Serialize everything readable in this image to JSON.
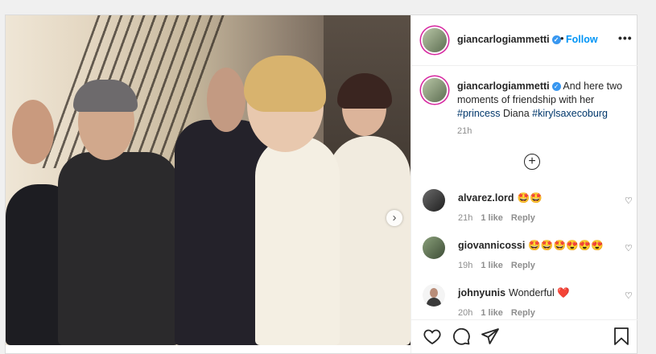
{
  "post": {
    "author": "giancarlogiammetti",
    "follow_label": "Follow",
    "separator": "•",
    "verified_mark": "✓",
    "more_label": "•••",
    "caption": {
      "username": "giancarlogiammetti",
      "text_before": "And here two moments of friendship with her",
      "hashtag1": "#princess",
      "middle": "Diana",
      "hashtag2": "#kirylsaxecoburg",
      "time": "21h"
    },
    "load_more_label": "+",
    "next_arrow": "›",
    "comments": [
      {
        "username": "alvarez.lord",
        "text": "🤩🤩",
        "time": "21h",
        "likes": "1 like",
        "reply": "Reply"
      },
      {
        "username": "giovannicossi",
        "text": "🤩🤩🤩😍😍😍",
        "time": "19h",
        "likes": "1 like",
        "reply": "Reply"
      },
      {
        "username": "johnyunis",
        "text": "Wonderful ❤️",
        "time": "20h",
        "likes": "1 like",
        "reply": "Reply"
      }
    ],
    "heart_icon": "♡",
    "icons": [
      "heart-icon",
      "comment-icon",
      "share-icon",
      "bookmark-icon"
    ],
    "colors": {
      "link": "#0095f6",
      "hashtag": "#00376b",
      "muted": "#8e8e8e",
      "story_ring": "#d6249f"
    }
  }
}
